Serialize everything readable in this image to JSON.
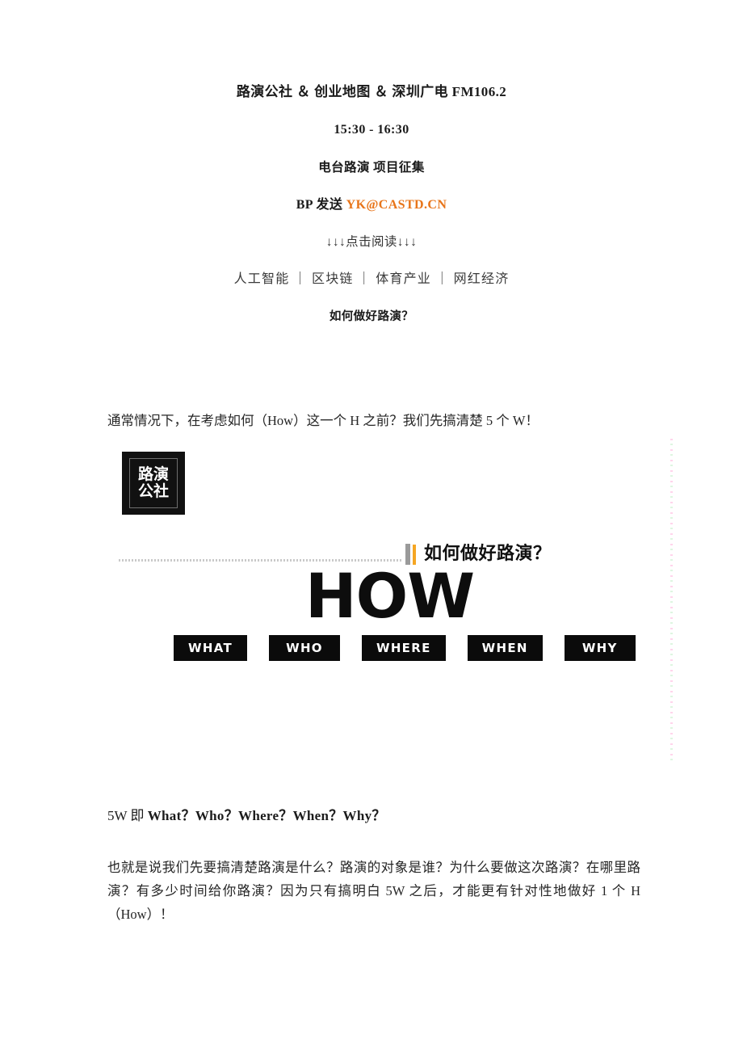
{
  "document": {
    "header": {
      "line_1": "路演公社 ＆ 创业地图 ＆ 深圳广电 FM106.2",
      "line_2": "15:30 - 16:30",
      "line_3": "电台路演 项目征集",
      "line_4_prefix": "BP 发送 ",
      "line_4_email": "YK@CASTD.CN",
      "line_5": "↓↓↓点击阅读↓↓↓",
      "line_6": "人工智能 ｜ 区块链 ｜ 体育产业 ｜ 网红经济",
      "line_7": "如何做好路演？"
    },
    "intro_paragraph": "通常情况下，在考虑如何（How）这一个 H 之前？我们先搞清楚 5 个 W！",
    "figure": {
      "logo_line_1": "路演",
      "logo_line_2": "公社",
      "subtitle": "如何做好路演？",
      "headline": "HOW",
      "chips": [
        "WHAT",
        "WHO",
        "WHERE",
        "WHEN",
        "WHY"
      ]
    },
    "fivew_line": {
      "prefix": "5W 即 ",
      "bold": "What？Who？Where？When？Why？"
    },
    "closing_paragraph": "也就是说我们先要搞清楚路演是什么？路演的对象是谁？为什么要做这次路演？在哪里路演？有多少时间给你路演？因为只有搞明白 5W 之后，才能更有针对性地做好 1 个 H（How）！"
  },
  "colors": {
    "accent_orange": "#e8751a",
    "figure_bar_orange": "#f5a623",
    "ink": "#1a1a1a",
    "chip_bg": "#0b0b0b"
  }
}
